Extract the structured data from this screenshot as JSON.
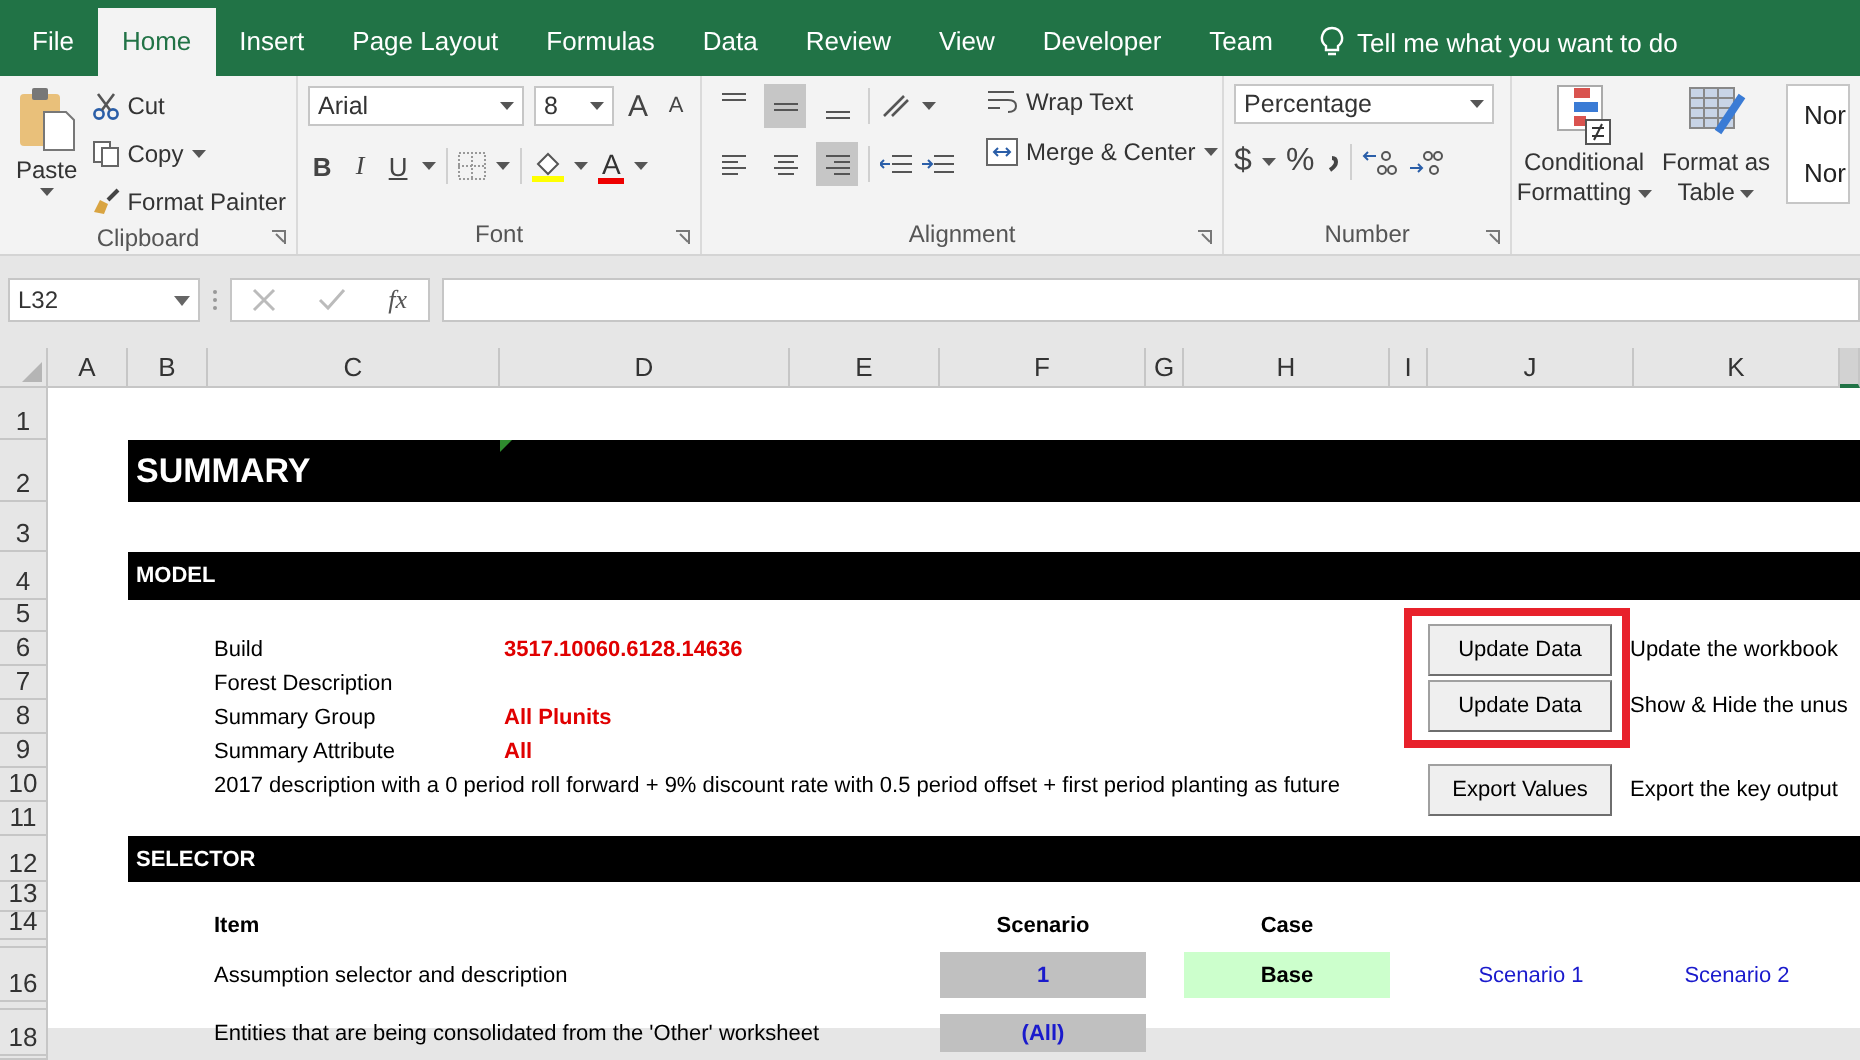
{
  "tabs": [
    {
      "label": "File",
      "selected": false
    },
    {
      "label": "Home",
      "selected": true
    },
    {
      "label": "Insert",
      "selected": false
    },
    {
      "label": "Page Layout",
      "selected": false
    },
    {
      "label": "Formulas",
      "selected": false
    },
    {
      "label": "Data",
      "selected": false
    },
    {
      "label": "Review",
      "selected": false
    },
    {
      "label": "View",
      "selected": false
    },
    {
      "label": "Developer",
      "selected": false
    },
    {
      "label": "Team",
      "selected": false
    }
  ],
  "tell_me": "Tell me what you want to do",
  "ribbon": {
    "clipboard": {
      "label": "Clipboard",
      "paste": "Paste",
      "cut": "Cut",
      "copy": "Copy",
      "format_painter": "Format Painter"
    },
    "font": {
      "label": "Font",
      "name": "Arial",
      "size": "8",
      "grow": "A",
      "shrink": "A",
      "bold": "B",
      "italic": "I",
      "underline": "U",
      "font_color": "A"
    },
    "alignment": {
      "label": "Alignment",
      "vertical": [
        {
          "selected": false
        },
        {
          "selected": true
        },
        {
          "selected": false
        }
      ],
      "horizontal": [
        {
          "selected": false
        },
        {
          "selected": false
        },
        {
          "selected": true
        }
      ],
      "wrap": "Wrap Text",
      "merge": "Merge & Center"
    },
    "number": {
      "label": "Number",
      "format": "Percentage",
      "currency": "$",
      "percent": "%"
    },
    "styles": {
      "conditional": [
        "Conditional",
        "Formatting"
      ],
      "format_table": [
        "Format as",
        "Table"
      ],
      "cell_styles": [
        "Nor",
        "Nor"
      ]
    }
  },
  "formula_bar": {
    "name_box": "L32",
    "fx": "fx"
  },
  "sheet": {
    "columns": [
      "A",
      "B",
      "C",
      "D",
      "E",
      "F",
      "G",
      "H",
      "I",
      "J",
      "K"
    ],
    "row_numbers": [
      "1",
      "2",
      "3",
      "4",
      "5",
      "6",
      "7",
      "8",
      "9",
      "10",
      "11",
      "12",
      "13",
      "14",
      "16",
      "18"
    ],
    "title": "SUMMARY",
    "model": {
      "header": "MODEL",
      "fields": [
        {
          "label": "Build",
          "value": "3517.10060.6128.14636"
        },
        {
          "label": "Forest Description"
        },
        {
          "label": "Summary Group",
          "value": "All Plunits"
        },
        {
          "label": "Summary Attribute",
          "value": "All"
        }
      ],
      "description": "2017 description with a 0 period roll forward + 9% discount rate with 0.5 period offset + first period planting as future",
      "action_groups": [
        {
          "highlighted": true,
          "actions": [
            {
              "button": "Update Data",
              "note": "Update the workbook"
            },
            {
              "button": "Update Data",
              "note": "Show & Hide the unus"
            }
          ]
        },
        {
          "highlighted": false,
          "actions": [
            {
              "button": "Export Values",
              "note": "Export the key output"
            }
          ]
        }
      ]
    },
    "selector": {
      "header": "SELECTOR",
      "columns": [
        "Item",
        "Scenario",
        "Case"
      ],
      "rows": [
        {
          "item": "Assumption selector and description",
          "scenario": "1",
          "case": "Base",
          "options": [
            "Scenario 1",
            "Scenario 2"
          ]
        },
        {
          "item": "Entities that are being consolidated from the 'Other' worksheet",
          "scenario": "(All)"
        }
      ]
    }
  }
}
